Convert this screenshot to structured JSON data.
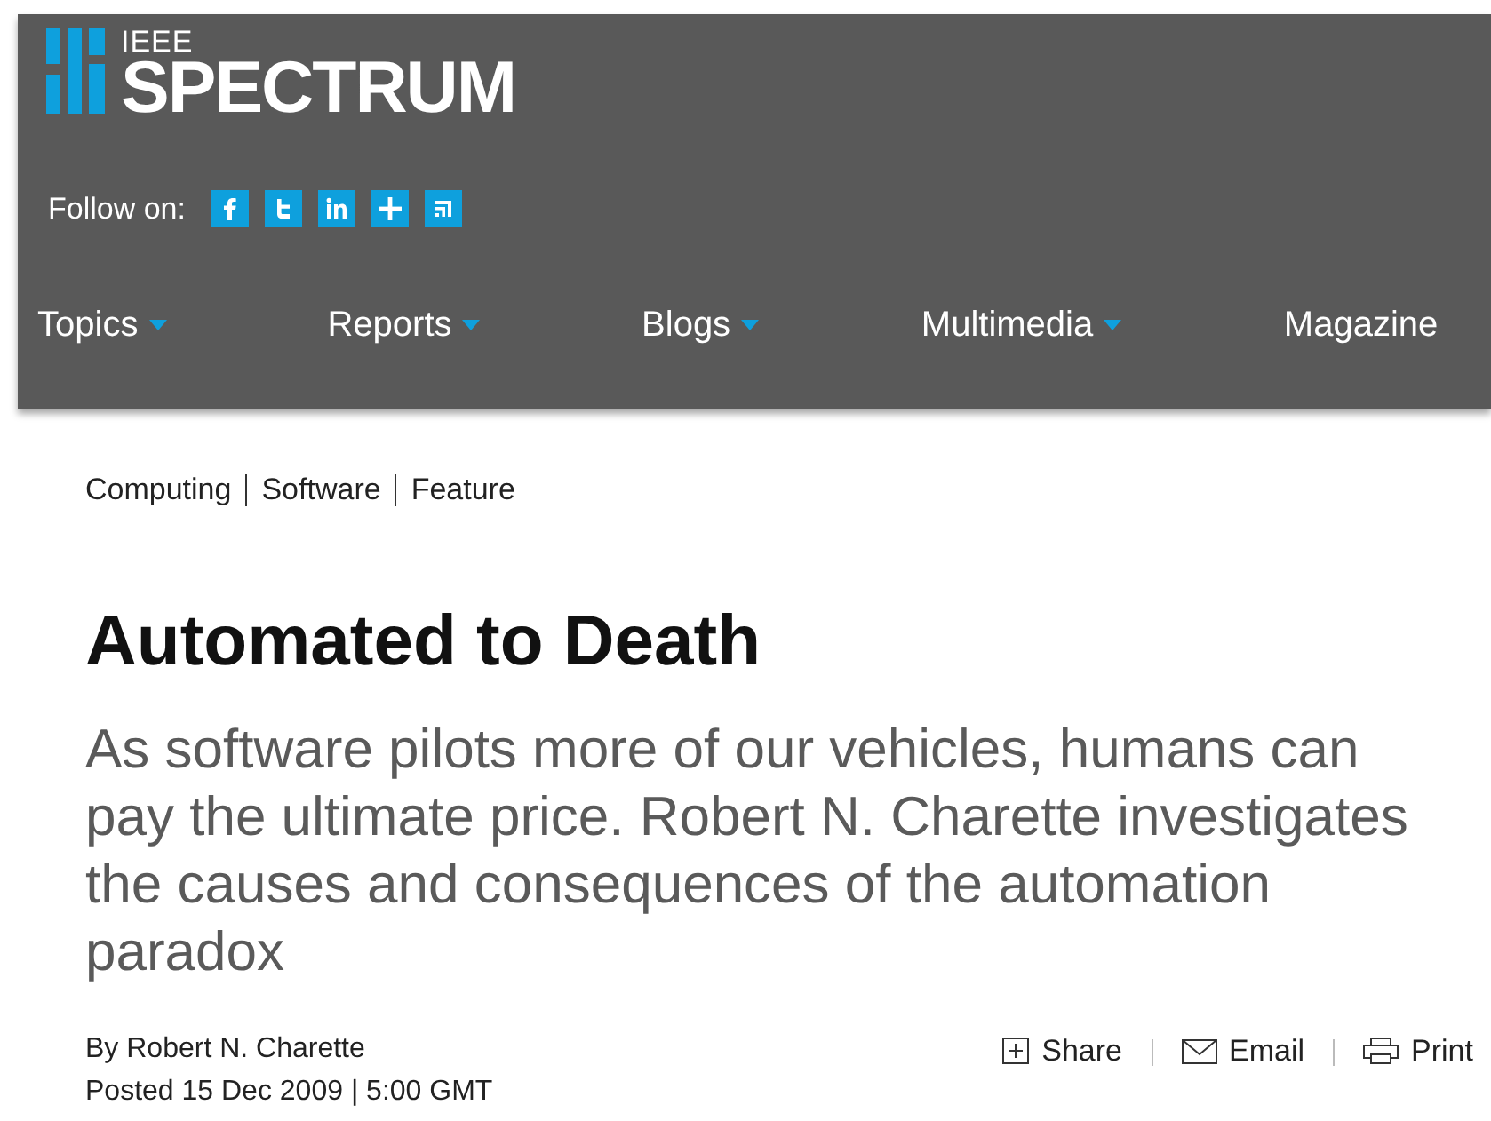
{
  "header": {
    "logo": {
      "small": "IEEE",
      "big": "SPECTRUM"
    },
    "follow_label": "Follow on:",
    "social": [
      {
        "kind": "facebook"
      },
      {
        "kind": "twitter"
      },
      {
        "kind": "linkedin"
      },
      {
        "kind": "plus"
      },
      {
        "kind": "rss"
      }
    ],
    "nav": [
      {
        "label": "Topics",
        "has_menu": true
      },
      {
        "label": "Reports",
        "has_menu": true
      },
      {
        "label": "Blogs",
        "has_menu": true
      },
      {
        "label": "Multimedia",
        "has_menu": true
      },
      {
        "label": "Magazine",
        "has_menu": false
      }
    ]
  },
  "breadcrumb": [
    "Computing",
    "Software",
    "Feature"
  ],
  "article": {
    "title": "Automated to Death",
    "subtitle": "As software pilots more of our vehicles, humans can pay the ultimate price. Robert N. Charette investigates the causes and consequences of the automation paradox",
    "byline": "By Robert N. Charette",
    "posted": "Posted 15 Dec 2009 | 5:00 GMT",
    "actions": [
      {
        "kind": "share",
        "label": "Share"
      },
      {
        "kind": "email",
        "label": "Email"
      },
      {
        "kind": "print",
        "label": "Print"
      }
    ]
  }
}
